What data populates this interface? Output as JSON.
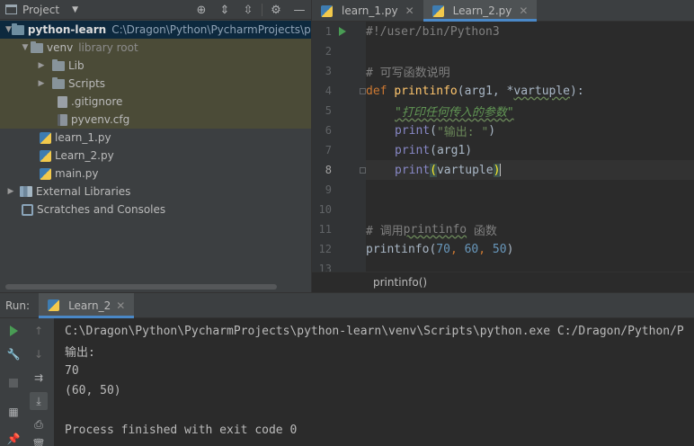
{
  "project_panel": {
    "title": "Project",
    "tree": [
      {
        "label": "python-learn",
        "extra": "C:\\Dragon\\Python\\PycharmProjects\\pytho"
      },
      {
        "label": "venv",
        "extra": "library root"
      },
      {
        "label": "Lib"
      },
      {
        "label": "Scripts"
      },
      {
        "label": ".gitignore"
      },
      {
        "label": "pyvenv.cfg"
      },
      {
        "label": "learn_1.py"
      },
      {
        "label": "Learn_2.py"
      },
      {
        "label": "main.py"
      },
      {
        "label": "External Libraries"
      },
      {
        "label": "Scratches and Consoles"
      }
    ]
  },
  "editor": {
    "tabs": [
      {
        "label": "learn_1.py"
      },
      {
        "label": "Learn_2.py"
      }
    ],
    "line_numbers": [
      "1",
      "2",
      "3",
      "4",
      "5",
      "6",
      "7",
      "8",
      "9",
      "10",
      "11",
      "12",
      "13"
    ],
    "code": {
      "l1": "#!/user/bin/Python3",
      "l3": "# 可写函数说明",
      "l4_kw": "def ",
      "l4_fn": "printinfo",
      "l4_a": "(arg1, *",
      "l4_b": "vartuple",
      "l4_c": "):",
      "l5": "\"打印任何传入的参数\"",
      "l6_fn": "print",
      "l6_a": "(",
      "l6_str": "\"输出: \"",
      "l6_b": ")",
      "l7_fn": "print",
      "l7_a": "(arg1)",
      "l8_fn": "print",
      "l8_open": "(",
      "l8_arg": "vartuple",
      "l8_close": ")",
      "l11_a": "# 调用",
      "l11_b": "printinfo",
      "l11_c": " 函数",
      "l12_fn": "printinfo",
      "l12_p1": "(",
      "l12_n1": "70",
      "l12_c1": ", ",
      "l12_n2": "60",
      "l12_c2": ", ",
      "l12_n3": "50",
      "l12_p2": ")"
    },
    "breadcrumb": "printinfo()"
  },
  "run_panel": {
    "label": "Run:",
    "tab": "Learn_2",
    "console": [
      "C:\\Dragon\\Python\\PycharmProjects\\python-learn\\venv\\Scripts\\python.exe C:/Dragon/Python/P",
      "输出:",
      "70",
      "(60, 50)",
      "",
      "Process finished with exit code 0"
    ]
  }
}
